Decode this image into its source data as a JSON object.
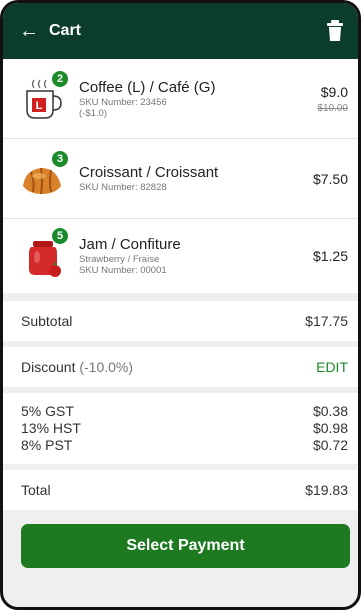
{
  "header": {
    "title": "Cart",
    "back_icon": "arrow-left-icon",
    "trash_icon": "trash-icon"
  },
  "items": [
    {
      "name": "Coffee (L) / Café (G)",
      "sku": "SKU Number: 23456",
      "note": "(-$1.0)",
      "qty": "2",
      "price": "$9.0",
      "was": "$10.00",
      "icon": "coffee-cup-icon"
    },
    {
      "name": "Croissant / Croissant",
      "sku": "SKU Number: 82828",
      "qty": "3",
      "price": "$7.50",
      "icon": "croissant-icon"
    },
    {
      "name": "Jam / Confiture",
      "variant": "Strawberry / Fraise",
      "sku": "SKU Number: 00001",
      "qty": "5",
      "price": "$1.25",
      "icon": "jam-jar-icon"
    }
  ],
  "summary": {
    "subtotal_label": "Subtotal",
    "subtotal_value": "$17.75",
    "discount_label": "Discount",
    "discount_pct": "(-10.0%)",
    "discount_edit": "EDIT",
    "taxes": [
      {
        "label": "5% GST",
        "value": "$0.38"
      },
      {
        "label": "13% HST",
        "value": "$0.98"
      },
      {
        "label": "8% PST",
        "value": "$0.72"
      }
    ],
    "total_label": "Total",
    "total_value": "$19.83"
  },
  "actions": {
    "pay_label": "Select Payment"
  },
  "colors": {
    "header": "#0b3d2a",
    "accent": "#1b8a2b",
    "button": "#1e7a20"
  }
}
